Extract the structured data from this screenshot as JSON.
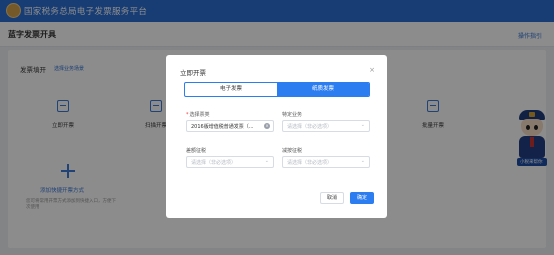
{
  "app": {
    "title": "国家税务总局电子发票服务平台",
    "page_title": "蓝字发票开具",
    "guide_link": "操作指引"
  },
  "background": {
    "section_title": "发票填开",
    "section_link": "选择业务场景",
    "tiles": [
      {
        "label": "立即开票"
      },
      {
        "label": "扫描开票"
      },
      {
        "label": "批量开票"
      }
    ],
    "add_label": "添加快捷开票方式",
    "add_desc": "您可将常用开票方式添加到快捷入口，方便下次使用",
    "mascot_text": "小税来帮你"
  },
  "dialog": {
    "title": "立即开票",
    "close_icon": "close-icon",
    "tabs": [
      {
        "label": "电子发票",
        "active": false
      },
      {
        "label": "纸质发票",
        "active": true
      }
    ],
    "fields": {
      "invoice_type": {
        "label": "选择票类",
        "required": true,
        "value": "2016版增值税普通发票（...",
        "placeholder": ""
      },
      "special_business": {
        "label": "特定业务",
        "value": "",
        "placeholder": "请选择（非必选项）"
      },
      "reduced_tax": {
        "label": "差额征税",
        "value": "",
        "placeholder": "请选择（非必选项）"
      },
      "tax_reduction": {
        "label": "减按征税",
        "value": "",
        "placeholder": "请选择（非必选项）"
      }
    },
    "cancel_label": "取消",
    "confirm_label": "确定"
  },
  "colors": {
    "primary": "#2c7df0",
    "header": "#2c6fd3",
    "overlay": "rgba(0,0,0,0.45)"
  }
}
